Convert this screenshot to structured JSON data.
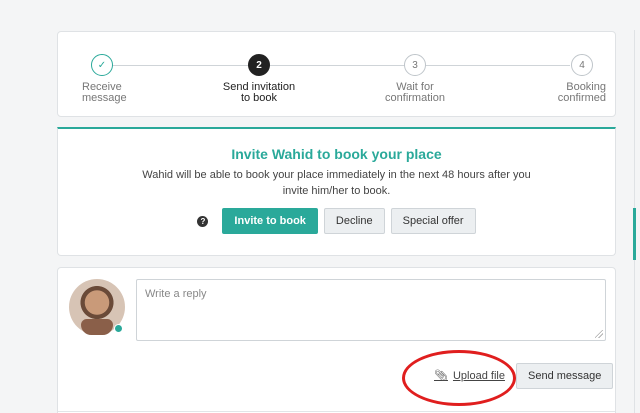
{
  "steps": [
    {
      "number": "✓",
      "label_line1": "Receive",
      "label_line2": "message",
      "state": "done"
    },
    {
      "number": "2",
      "label_line1": "Send invitation",
      "label_line2": "to book",
      "state": "active"
    },
    {
      "number": "3",
      "label_line1": "Wait for",
      "label_line2": "confirmation",
      "state": "pending"
    },
    {
      "number": "4",
      "label_line1": "Booking",
      "label_line2": "confirmed",
      "state": "pending"
    }
  ],
  "invite": {
    "title": "Invite Wahid to book your place",
    "description": "Wahid will be able to book your place immediately in the next 48 hours after you invite him/her to book.",
    "help_icon": "?",
    "invite_button": "Invite to book",
    "decline_button": "Decline",
    "special_offer_button": "Special offer"
  },
  "reply": {
    "placeholder": "Write a reply",
    "upload_label": "Upload file",
    "upload_icon": "paperclip-icon",
    "send_button": "Send message"
  },
  "colors": {
    "accent": "#2aa99a",
    "annotation": "#e01e1e"
  }
}
